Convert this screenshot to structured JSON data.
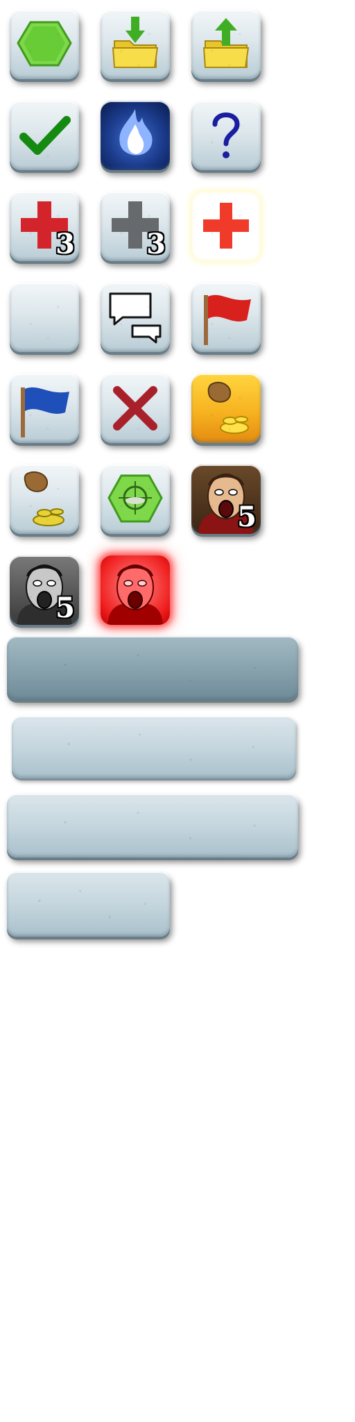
{
  "sprite_sheet": {
    "buttons": [
      {
        "name": "hexagon-button",
        "icon": "green-hexagon-icon"
      },
      {
        "name": "load-button",
        "icon": "folder-download-icon"
      },
      {
        "name": "save-button",
        "icon": "folder-upload-icon"
      },
      {
        "name": "confirm-button",
        "icon": "green-checkmark-icon"
      },
      {
        "name": "fire-button",
        "icon": "blue-flame-icon"
      },
      {
        "name": "help-button",
        "icon": "question-mark-icon"
      },
      {
        "name": "heal-red-button",
        "icon": "red-cross-icon",
        "count": "3"
      },
      {
        "name": "heal-gray-button",
        "icon": "gray-cross-icon",
        "count": "3"
      },
      {
        "name": "heal-highlight-button",
        "icon": "red-cross-icon"
      },
      {
        "name": "blank-button",
        "icon": ""
      },
      {
        "name": "chat-button",
        "icon": "speech-bubbles-icon"
      },
      {
        "name": "red-flag-button",
        "icon": "red-flag-icon"
      },
      {
        "name": "blue-flag-button",
        "icon": "blue-flag-icon"
      },
      {
        "name": "cancel-button",
        "icon": "red-x-icon"
      },
      {
        "name": "gold-money-button",
        "icon": "money-bag-coins-icon"
      },
      {
        "name": "money-button",
        "icon": "money-bag-coins-icon"
      },
      {
        "name": "target-hex-button",
        "icon": "crosshair-hexagon-icon"
      },
      {
        "name": "villain-color-button",
        "icon": "screaming-man-portrait-icon",
        "count": "5"
      },
      {
        "name": "villain-gray-button",
        "icon": "screaming-man-gray-portrait-icon",
        "count": "5"
      },
      {
        "name": "villain-red-button",
        "icon": "screaming-man-red-portrait-icon"
      }
    ],
    "bars": [
      {
        "name": "wide-bar-dark"
      },
      {
        "name": "wide-bar-flat"
      },
      {
        "name": "wide-bar-light"
      },
      {
        "name": "short-bar"
      }
    ]
  },
  "colors": {
    "button_face": "#dde7ec",
    "button_edge": "#6a7d87",
    "icon_green": "#58c82a",
    "icon_red": "#e0242a",
    "icon_blue": "#1f4fb8",
    "icon_gold": "#f7b320",
    "icon_folder": "#f4d73b"
  }
}
